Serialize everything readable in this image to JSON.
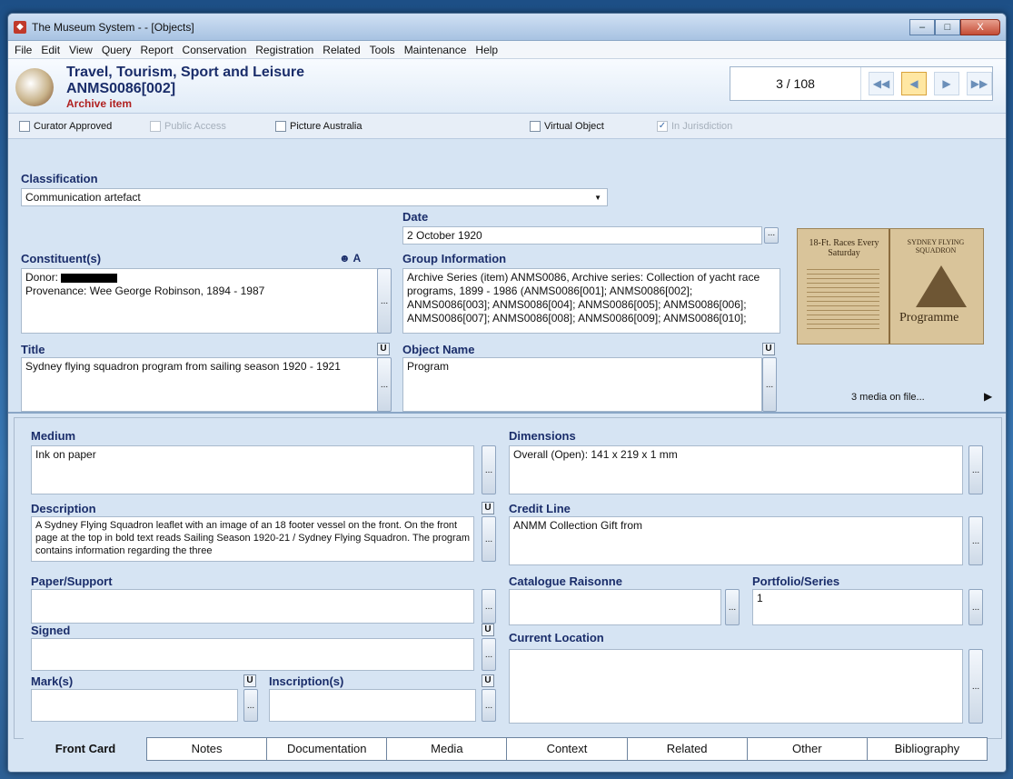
{
  "window": {
    "title": "The Museum System -  - [Objects]",
    "min": "–",
    "max": "□",
    "close": "X"
  },
  "menu": [
    "File",
    "Edit",
    "View",
    "Query",
    "Report",
    "Conservation",
    "Registration",
    "Related",
    "Tools",
    "Maintenance",
    "Help"
  ],
  "header": {
    "title": "Travel, Tourism, Sport and Leisure",
    "number": "ANMS0086[002]",
    "subtitle": "Archive item",
    "nav_count": "3 / 108"
  },
  "checkboxes": [
    {
      "label": "Curator Approved",
      "checked": false,
      "disabled": false
    },
    {
      "label": "Public Access",
      "checked": false,
      "disabled": true
    },
    {
      "label": "Picture Australia",
      "checked": false,
      "disabled": false
    },
    {
      "label": "Virtual Object",
      "checked": false,
      "disabled": false
    },
    {
      "label": "In Jurisdiction",
      "checked": true,
      "disabled": true
    }
  ],
  "upper": {
    "classification_label": "Classification",
    "classification_value": "Communication artefact",
    "date_label": "Date",
    "date_value": "2 October 1920",
    "constituents_label": "Constituent(s)",
    "donor_label": "Donor:",
    "provenance": "Provenance:  Wee George Robinson, 1894 - 1987",
    "group_label": "Group Information",
    "group_value": "Archive Series (item) ANMS0086, Archive series: Collection of yacht race programs, 1899 - 1986 (ANMS0086[001]; ANMS0086[002]; ANMS0086[003]; ANMS0086[004]; ANMS0086[005]; ANMS0086[006]; ANMS0086[007]; ANMS0086[008]; ANMS0086[009]; ANMS0086[010];",
    "title_label": "Title",
    "title_value": "Sydney flying squadron program from sailing season 1920 - 1921",
    "object_name_label": "Object Name",
    "object_name_value": "Program",
    "media_text": "3 media on file...",
    "thumb_heading_left": "18-Ft. Races Every Saturday",
    "thumb_heading_right": "SYDNEY FLYING SQUADRON",
    "thumb_programme": "Programme"
  },
  "lower": {
    "medium_label": "Medium",
    "medium_value": "Ink on paper",
    "dimensions_label": "Dimensions",
    "dimensions_value": "Overall (Open): 141 x 219 x 1 mm",
    "description_label": "Description",
    "description_value": "A Sydney Flying Squadron leaflet with an image of an 18 footer vessel on the front. On the front page at the top in bold text reads Sailing Season 1920-21 / Sydney Flying Squadron. The program contains information regarding the three",
    "credit_label": "Credit Line",
    "credit_value": "ANMM Collection Gift from",
    "paper_label": "Paper/Support",
    "catalogue_label": "Catalogue Raisonne",
    "portfolio_label": "Portfolio/Series",
    "portfolio_value": "1",
    "signed_label": "Signed",
    "location_label": "Current Location",
    "marks_label": "Mark(s)",
    "inscriptions_label": "Inscription(s)"
  },
  "tabs": [
    "Front Card",
    "Notes",
    "Documentation",
    "Media",
    "Context",
    "Related",
    "Other",
    "Bibliography"
  ],
  "ubutton": "U",
  "ellipsis": "..."
}
